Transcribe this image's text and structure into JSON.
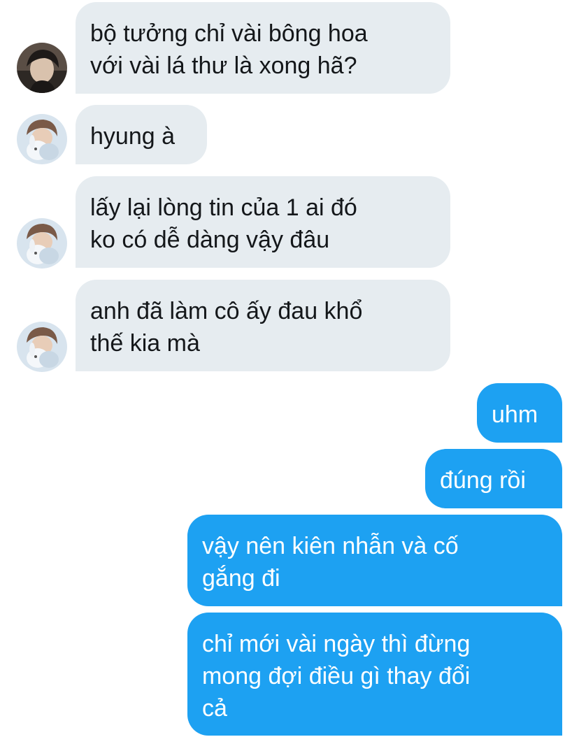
{
  "conversation": {
    "messages": [
      {
        "sender": "other",
        "avatar": "dark-haired-person-avatar",
        "lines": [
          "bộ tưởng chỉ vài bông hoa",
          "với vài lá thư là xong hã?"
        ]
      },
      {
        "sender": "other",
        "avatar": "person-holding-plush-avatar",
        "lines": [
          "hyung à"
        ]
      },
      {
        "sender": "other",
        "avatar": "person-holding-plush-avatar",
        "lines": [
          "lấy lại lòng tin của 1 ai đó",
          "ko có dễ dàng vậy đâu"
        ]
      },
      {
        "sender": "other",
        "avatar": "person-holding-plush-avatar",
        "lines": [
          "anh đã làm cô ấy đau khổ",
          "thế kia mà"
        ]
      },
      {
        "sender": "me",
        "lines": [
          "uhm"
        ]
      },
      {
        "sender": "me",
        "lines": [
          "đúng rồi"
        ]
      },
      {
        "sender": "me",
        "lines": [
          "vậy nên kiên nhẫn và cố",
          "gắng đi"
        ]
      },
      {
        "sender": "me",
        "lines": [
          "chỉ mới vài ngày thì đừng",
          "mong đợi điều gì thay đổi",
          "cả"
        ]
      }
    ]
  },
  "colors": {
    "incoming_bubble": "#e6ecf0",
    "incoming_text": "#14171a",
    "outgoing_bubble": "#1da1f2",
    "outgoing_text": "#ffffff",
    "background": "#ffffff"
  }
}
